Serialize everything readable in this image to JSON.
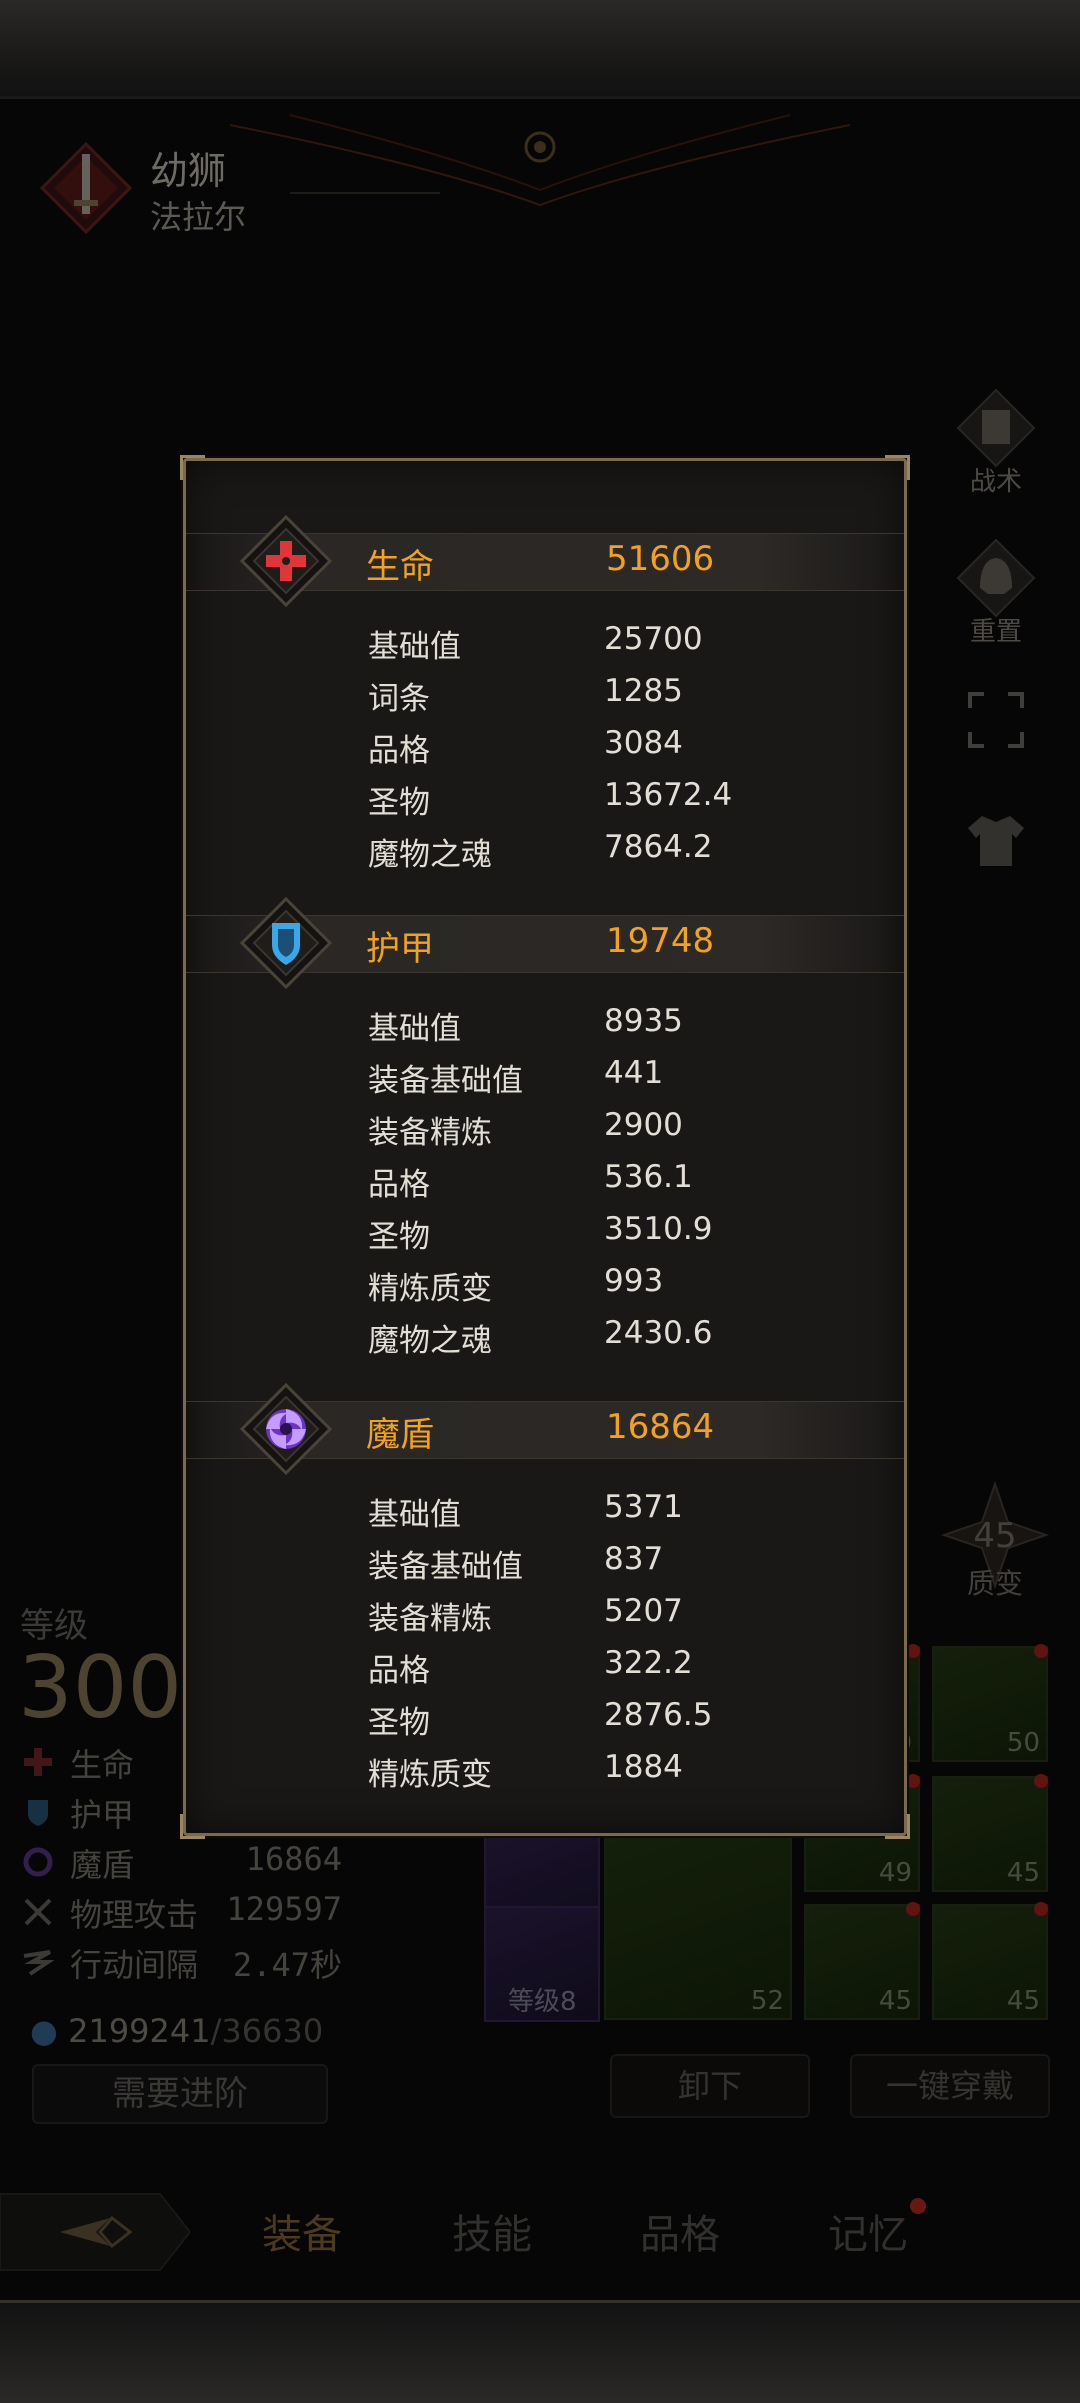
{
  "hero": {
    "title": "幼狮",
    "subtitle": "法拉尔"
  },
  "side_buttons": {
    "tactics": "战术",
    "reset": "重置"
  },
  "background": {
    "level_label": "等级",
    "level_value": "300",
    "stats": [
      {
        "name": "生命",
        "value": "51606"
      },
      {
        "name": "护甲",
        "value": "19748"
      },
      {
        "name": "魔盾",
        "value": "16864"
      },
      {
        "name": "物理攻击",
        "value": "129597"
      },
      {
        "name": "行动间隔",
        "value": "2.47秒"
      }
    ],
    "gold_current": "2199241",
    "gold_required": "/36630",
    "advance_button": "需要进阶",
    "quality_change_count": "45",
    "quality_change_label": "质变",
    "unequip_button": "卸下",
    "equip_all_button": "一键穿戴",
    "slot_levels": [
      "50",
      "50",
      "49",
      "45",
      "52",
      "45",
      "45"
    ],
    "slot_lv_label": "等级8"
  },
  "nav": {
    "tabs": [
      "装备",
      "技能",
      "品格",
      "记忆"
    ],
    "active": "装备"
  },
  "popup": {
    "sections": [
      {
        "name": "生命",
        "total": "51606",
        "icon": "health-cross-icon",
        "rows": [
          {
            "label": "基础值",
            "value": "25700"
          },
          {
            "label": "词条",
            "value": "1285"
          },
          {
            "label": "品格",
            "value": "3084"
          },
          {
            "label": "圣物",
            "value": "13672.4"
          },
          {
            "label": "魔物之魂",
            "value": "7864.2"
          }
        ]
      },
      {
        "name": "护甲",
        "total": "19748",
        "icon": "armor-shield-icon",
        "rows": [
          {
            "label": "基础值",
            "value": "8935"
          },
          {
            "label": "装备基础值",
            "value": "441"
          },
          {
            "label": "装备精炼",
            "value": "2900"
          },
          {
            "label": "品格",
            "value": "536.1"
          },
          {
            "label": "圣物",
            "value": "3510.9"
          },
          {
            "label": "精炼质变",
            "value": "993"
          },
          {
            "label": "魔物之魂",
            "value": "2430.6"
          }
        ]
      },
      {
        "name": "魔盾",
        "total": "16864",
        "icon": "magic-shield-swirl-icon",
        "rows": [
          {
            "label": "基础值",
            "value": "5371"
          },
          {
            "label": "装备基础值",
            "value": "837"
          },
          {
            "label": "装备精炼",
            "value": "5207"
          },
          {
            "label": "品格",
            "value": "322.2"
          },
          {
            "label": "圣物",
            "value": "2876.5"
          },
          {
            "label": "精炼质变",
            "value": "1884"
          }
        ]
      }
    ]
  },
  "colors": {
    "accent_gold": "#f2a21c",
    "health_red": "#e0353b",
    "armor_blue": "#3aa7e8",
    "magic_purple": "#8e4fe0"
  }
}
